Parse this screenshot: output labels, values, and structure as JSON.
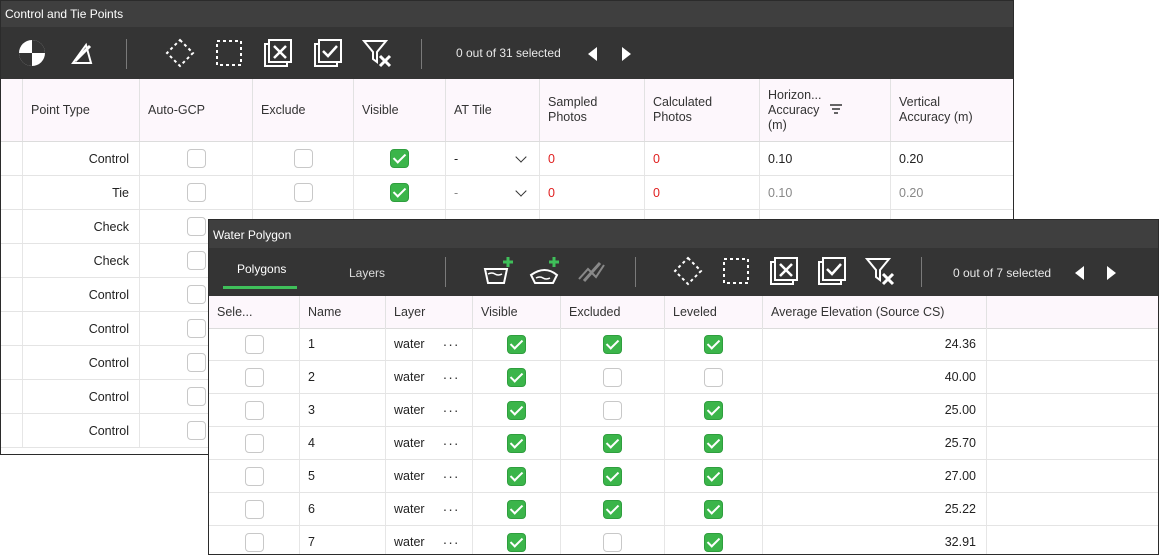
{
  "ctp": {
    "title": "Control and Tie Points",
    "toolbar": {
      "icons": [
        "target-icon",
        "edit-point-icon",
        "select-polygon-icon",
        "select-rectangle-icon",
        "deselect-icon",
        "select-all-icon",
        "clear-filter-icon"
      ],
      "selection": "0 out of 31 selected"
    },
    "columns": {
      "point_type": "Point Type",
      "auto_gcp": "Auto-GCP",
      "exclude": "Exclude",
      "visible": "Visible",
      "at_tile": "AT Tile",
      "sampled_1": "Sampled",
      "sampled_2": "Photos",
      "calculated_1": "Calculated",
      "calculated_2": "Photos",
      "horiz_1": "Horizon...",
      "horiz_2": "Accuracy",
      "horiz_3": "(m)",
      "vert_1": "Vertical",
      "vert_2": "Accuracy (m)"
    },
    "rows": [
      {
        "type": "Control",
        "at_tile": "-",
        "sampled": "0",
        "calculated": "0",
        "horiz": "0.10",
        "vert": "0.20"
      },
      {
        "type": "Tie",
        "at_tile": "-",
        "sampled": "0",
        "calculated": "0",
        "horiz": "0.10",
        "vert": "0.20"
      },
      {
        "type": "Check"
      },
      {
        "type": "Check"
      },
      {
        "type": "Control"
      },
      {
        "type": "Control"
      },
      {
        "type": "Control"
      },
      {
        "type": "Control"
      },
      {
        "type": "Control"
      }
    ]
  },
  "wp": {
    "title": "Water Polygon",
    "tabs": {
      "polygons": "Polygons",
      "layers": "Layers"
    },
    "toolbar": {
      "icons": [
        "add-water-polygon-icon",
        "add-water-polygon-alt-icon",
        "edit-polygon-icon",
        "select-polygon-icon",
        "select-rectangle-icon",
        "deselect-icon",
        "select-all-icon",
        "clear-filter-icon"
      ],
      "selection": "0 out of 7 selected"
    },
    "columns": {
      "select": "Sele...",
      "name": "Name",
      "layer": "Layer",
      "visible": "Visible",
      "excluded": "Excluded",
      "leveled": "Leveled",
      "avg_elev": "Average Elevation (Source CS)"
    },
    "rows": [
      {
        "name": "1",
        "layer": "water",
        "dots": "···",
        "visible": true,
        "excluded": true,
        "leveled": true,
        "elev": "24.36"
      },
      {
        "name": "2",
        "layer": "water",
        "dots": "···",
        "visible": true,
        "excluded": false,
        "leveled": false,
        "elev": "40.00"
      },
      {
        "name": "3",
        "layer": "water",
        "dots": "···",
        "visible": true,
        "excluded": false,
        "leveled": true,
        "elev": "25.00"
      },
      {
        "name": "4",
        "layer": "water",
        "dots": "···",
        "visible": true,
        "excluded": true,
        "leveled": true,
        "elev": "25.70"
      },
      {
        "name": "5",
        "layer": "water",
        "dots": "···",
        "visible": true,
        "excluded": true,
        "leveled": true,
        "elev": "27.00"
      },
      {
        "name": "6",
        "layer": "water",
        "dots": "···",
        "visible": true,
        "excluded": true,
        "leveled": true,
        "elev": "25.22"
      },
      {
        "name": "7",
        "layer": "water",
        "dots": "···",
        "visible": true,
        "excluded": false,
        "leveled": true,
        "elev": "32.91"
      }
    ]
  },
  "colors": {
    "accent_green": "#3bb54a",
    "toolbar_bg": "#343434",
    "title_bg": "#3f3f3f",
    "error_red": "#e02020"
  }
}
